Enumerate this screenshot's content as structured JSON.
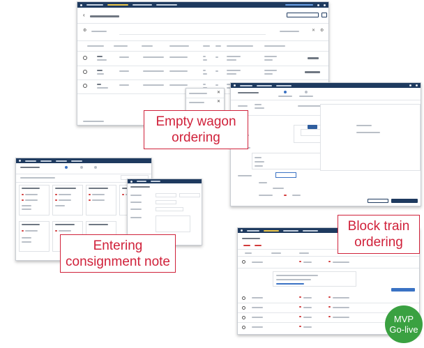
{
  "callouts": {
    "empty_wagon": "Empty wagon ordering",
    "consignment": "Entering consignment note",
    "block_train": "Block train ordering"
  },
  "badge": {
    "line1": "MVP",
    "line2": "Go-live"
  },
  "colors": {
    "callout_border": "#d0213a",
    "callout_text": "#d0213a",
    "nav_bar": "#1e3a5f",
    "badge": "#3aa141"
  },
  "icons": [
    "back-arrow-icon",
    "filter-icon",
    "gear-icon",
    "close-icon",
    "radio-icon"
  ]
}
